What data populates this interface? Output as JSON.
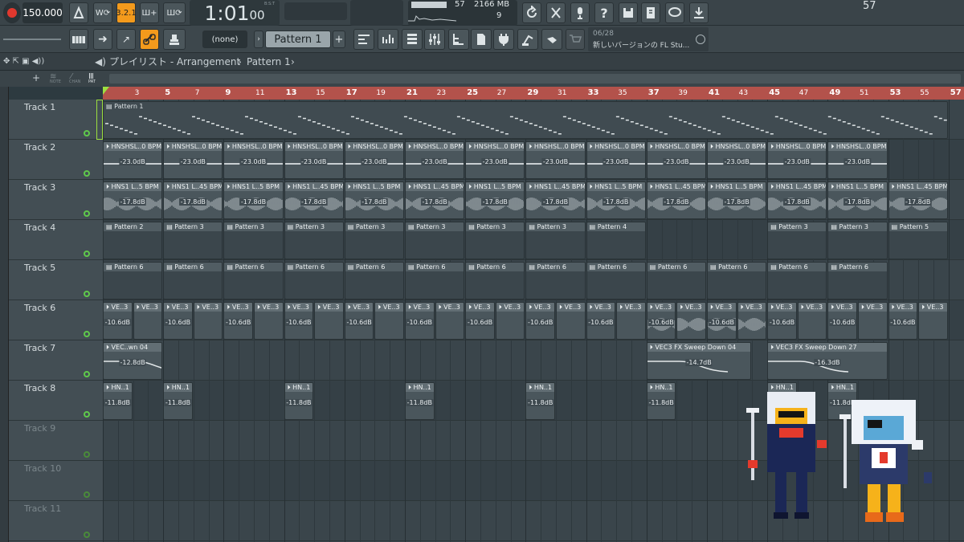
{
  "toolbar": {
    "tempo": "150.000",
    "time": "1:01",
    "time_frac": "00",
    "time_unit": "B:S:T",
    "cpu": "57",
    "memory": "2166 MB",
    "voices": "9",
    "snap": "(none)",
    "pattern": "Pattern 1",
    "news_date": "06/28",
    "news_text": "新しいバージョンの FL Stu..."
  },
  "titlebar": {
    "prefix": "プレイリスト - Arrangement",
    "sep": "›",
    "pattern": "Pattern 1"
  },
  "subheader": {
    "labels": [
      "NOTE",
      "CHAN",
      "PAT"
    ]
  },
  "ruler": {
    "ticks": [
      "3",
      "5",
      "7",
      "9",
      "11",
      "13",
      "15",
      "17",
      "19",
      "21",
      "23",
      "25",
      "27",
      "29",
      "31",
      "33",
      "35",
      "37",
      "39",
      "41",
      "43",
      "45",
      "47",
      "49",
      "51",
      "53",
      "55",
      "57"
    ]
  },
  "tracks": [
    "Track 1",
    "Track 2",
    "Track 3",
    "Track 4",
    "Track 5",
    "Track 6",
    "Track 7",
    "Track 8",
    "Track 9",
    "Track 10",
    "Track 11"
  ],
  "clips": {
    "p1": "Pattern 1",
    "t2": "HNSHSL..0 BPM",
    "t2vol": "-23.0dB",
    "t3a": "HNS1 L..5 BPM",
    "t3b": "HNS1 L..45 BPM",
    "t3vol": "-17.8dB",
    "p2": "Pattern 2",
    "p3": "Pattern 3",
    "p4": "Pattern 4",
    "p5": "Pattern 5",
    "p6": "Pattern 6",
    "ve3": "VE..3",
    "t6vol": "-10.6dB",
    "t7a": "VEC..wn 04",
    "t7avol": "-12.8dB",
    "t7b": "VEC3 FX Sweep Down 04",
    "t7bvol": "-14.7dB",
    "t7c": "VEC3 FX Sweep Down 27",
    "t7cvol": "-16.3dB",
    "hn": "HN..1",
    "t8vol": "-11.8dB"
  },
  "colors": {
    "ruler": "#b3524b",
    "record": "#e0382e",
    "accent_orange": "#f39a1c",
    "track_active": "#5fc94b"
  }
}
